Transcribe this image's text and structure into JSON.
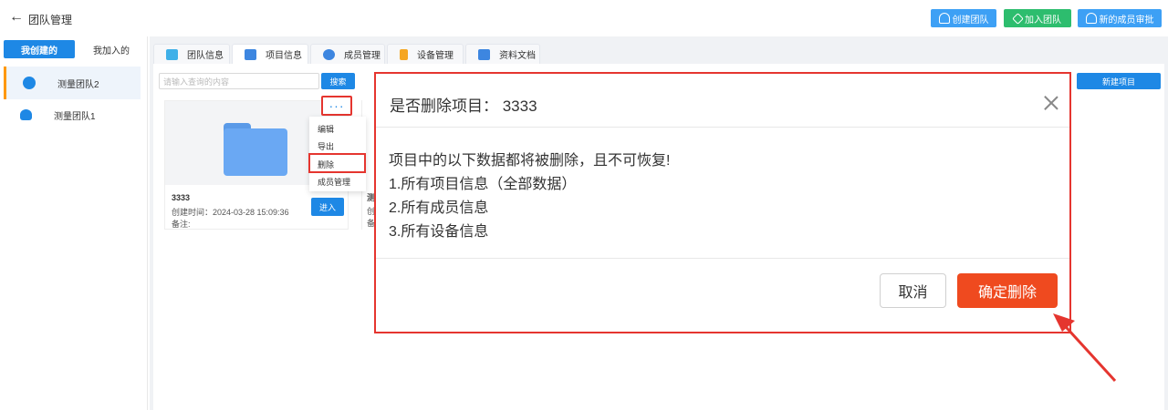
{
  "header": {
    "title": "团队管理",
    "back_icon": "arrow-left-icon",
    "buttons": [
      {
        "label": "创建团队",
        "icon": "user-add-icon",
        "color": "#3da0f5"
      },
      {
        "label": "加入团队",
        "icon": "tag-icon",
        "color": "#2dbd6e"
      },
      {
        "label": "新的成员审批",
        "icon": "user-check-icon",
        "color": "#3da0f5"
      }
    ]
  },
  "sidebar": {
    "tabs": [
      {
        "label": "我创建的",
        "active": true
      },
      {
        "label": "我加入的",
        "active": false
      }
    ],
    "teams": [
      {
        "name": "测量团队2",
        "icon": "team-icon",
        "active": true
      },
      {
        "name": "测量团队1",
        "icon": "user-icon",
        "active": false
      }
    ]
  },
  "tabs": [
    {
      "label": "团队信息",
      "icon": "team-info-icon",
      "color": "#3fb0e8"
    },
    {
      "label": "项目信息",
      "icon": "folder-icon",
      "color": "#3d86e0",
      "active": true
    },
    {
      "label": "成员管理",
      "icon": "members-icon",
      "color": "#3d86e0"
    },
    {
      "label": "设备管理",
      "icon": "device-icon",
      "color": "#f5a623"
    },
    {
      "label": "资料文档",
      "icon": "docs-icon",
      "color": "#3d86e0"
    }
  ],
  "search": {
    "placeholder": "请输入查询的内容",
    "button_label": "搜索"
  },
  "new_project_label": "新建项目",
  "project_card": {
    "name": "3333",
    "created": "创建时间：2024-03-28 15:09:36",
    "note": "备注:",
    "enter_label": "进入",
    "more_label": "···"
  },
  "card2_peek": [
    "测",
    "创",
    "备"
  ],
  "dropdown": {
    "items": [
      "编辑",
      "导出",
      "删除",
      "成员管理"
    ]
  },
  "modal": {
    "title": "是否删除项目： 3333",
    "lines": [
      "项目中的以下数据都将被删除，且不可恢复!",
      "1.所有项目信息（全部数据）",
      "2.所有成员信息",
      "3.所有设备信息"
    ],
    "cancel_label": "取消",
    "confirm_label": "确定删除"
  },
  "colors": {
    "primary": "#1e88e5",
    "danger": "#ef4a1f",
    "annotation": "#e5352f"
  }
}
